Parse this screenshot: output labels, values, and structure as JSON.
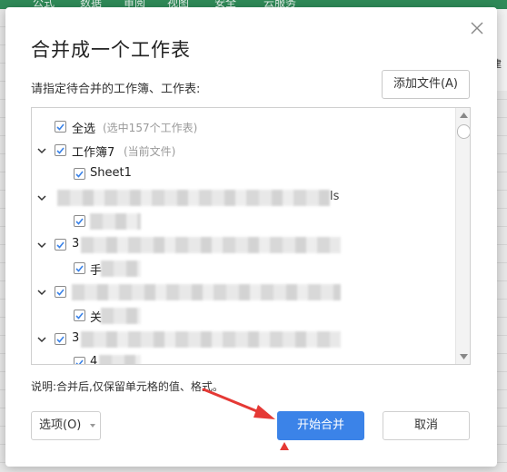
{
  "background": {
    "ribbon_tabs": [
      "公式",
      "数据",
      "审阅",
      "视图",
      "安全",
      "云服务"
    ],
    "right_panel": [
      "s",
      "建",
      "A"
    ]
  },
  "dialog": {
    "title": "合并成一个工作表",
    "instruction": "请指定待合并的工作簿、工作表:",
    "add_file_label": "添加文件(A)",
    "note": "说明:合并后,仅保留单元格的值、格式。",
    "options_label": "选项(O)",
    "start_label": "开始合并",
    "cancel_label": "取消"
  },
  "list": {
    "select_all": {
      "label": "全选",
      "hint": "(选中157个工作表)"
    },
    "workbook": {
      "label": "工作簿7",
      "hint": "(当前文件)"
    },
    "sheet": {
      "label": "Sheet1"
    },
    "file2_tail": "ls",
    "file3_prefix": "3",
    "sub3_prefix": "手",
    "sub4_prefix": "关",
    "file5_prefix": "3",
    "sub5_prefix": "4"
  },
  "colors": {
    "accent": "#3b83e8",
    "annotation": "#e53935",
    "ribbon": "#2f8a58"
  }
}
